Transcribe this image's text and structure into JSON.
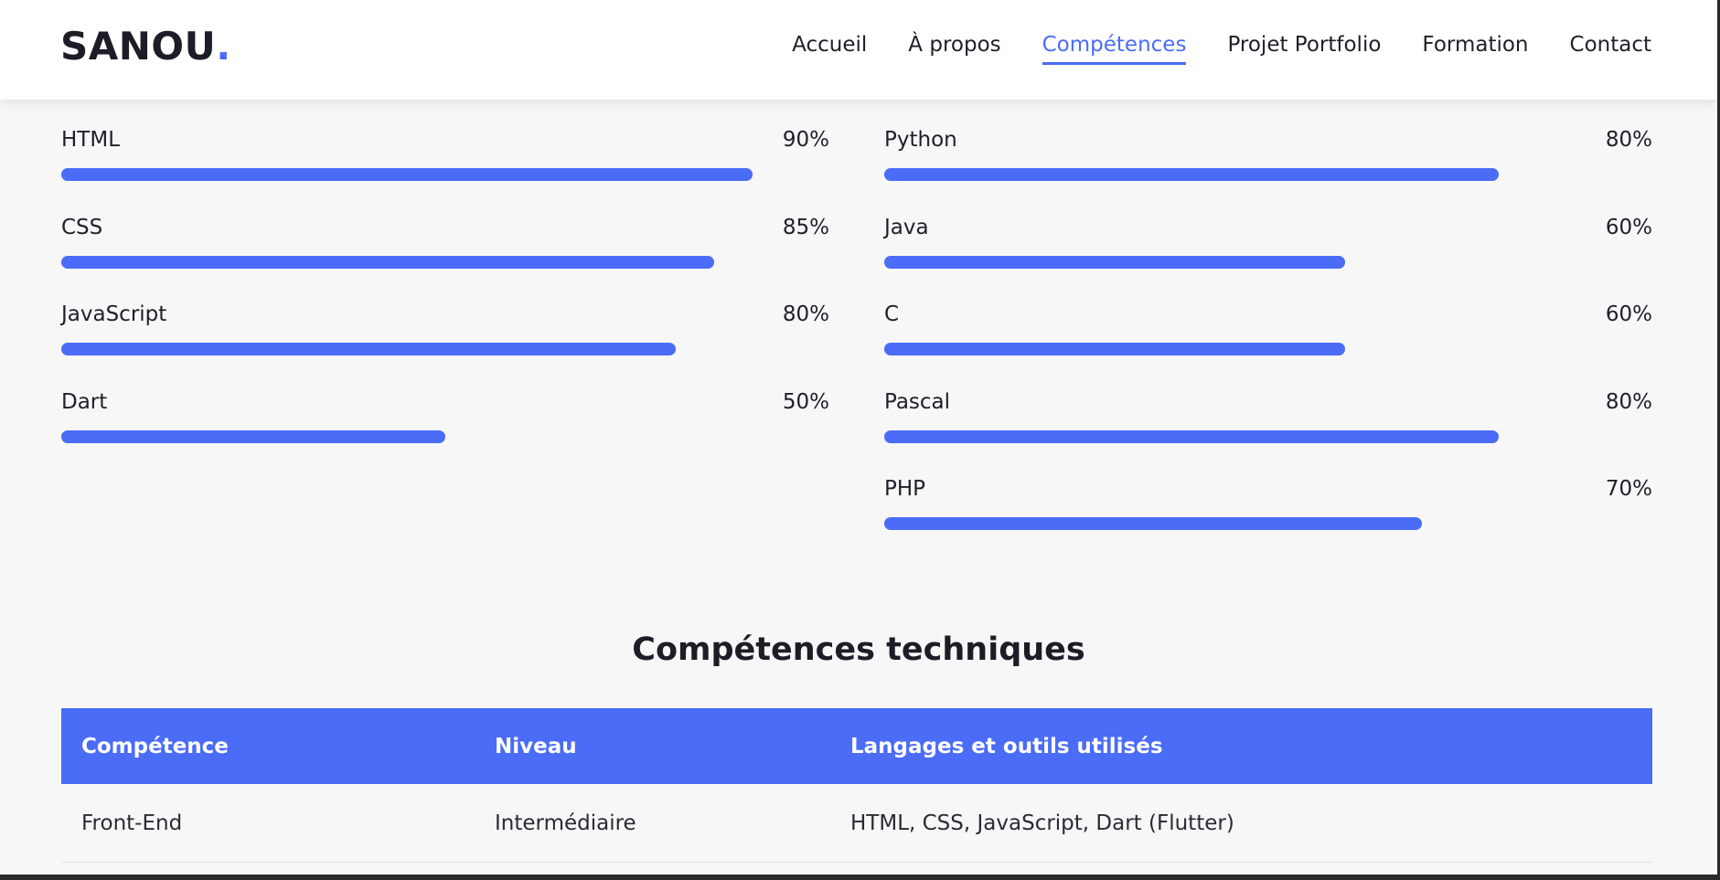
{
  "header": {
    "logo_text": "SANOU",
    "logo_dot": ".",
    "nav": [
      {
        "label": "Accueil",
        "active": false
      },
      {
        "label": "À propos",
        "active": false
      },
      {
        "label": "Compétences",
        "active": true
      },
      {
        "label": "Projet Portfolio",
        "active": false
      },
      {
        "label": "Formation",
        "active": false
      },
      {
        "label": "Contact",
        "active": false
      }
    ]
  },
  "skills": {
    "left": [
      {
        "name": "HTML",
        "percent_label": "90%",
        "level": 90
      },
      {
        "name": "CSS",
        "percent_label": "85%",
        "level": 85
      },
      {
        "name": "JavaScript",
        "percent_label": "80%",
        "level": 80
      },
      {
        "name": "Dart",
        "percent_label": "50%",
        "level": 50
      }
    ],
    "right": [
      {
        "name": "Python",
        "percent_label": "80%",
        "level": 80
      },
      {
        "name": "Java",
        "percent_label": "60%",
        "level": 60
      },
      {
        "name": "C",
        "percent_label": "60%",
        "level": 60
      },
      {
        "name": "Pascal",
        "percent_label": "80%",
        "level": 80
      },
      {
        "name": "PHP",
        "percent_label": "70%",
        "level": 70
      }
    ]
  },
  "section": {
    "title": "Compétences techniques"
  },
  "table": {
    "headers": [
      "Compétence",
      "Niveau",
      "Langages et outils utilisés"
    ],
    "rows": [
      [
        "Front-End",
        "Intermédiaire",
        "HTML, CSS, JavaScript, Dart (Flutter)"
      ]
    ]
  },
  "colors": {
    "accent": "#4a6cf7",
    "text": "#1f1f2b",
    "background": "#f7f7f7"
  }
}
